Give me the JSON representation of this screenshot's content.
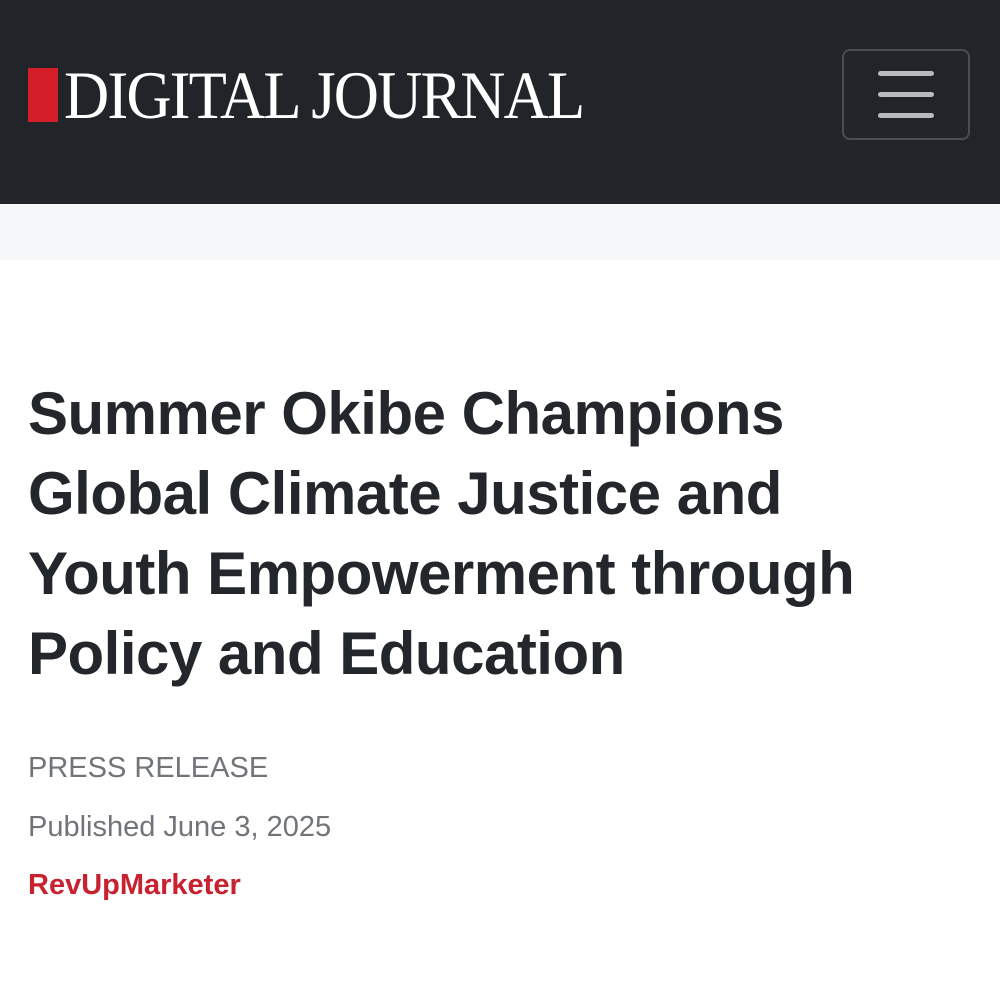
{
  "header": {
    "logo_text": "DIGITAL JOURNAL",
    "background_color": "#212428",
    "logo_mark_color": "#d41f2b",
    "menu_icon": "hamburger-menu-icon"
  },
  "article": {
    "title": "Summer Okibe Champions Global Climate Justice and Youth Empowerment through Policy and Education",
    "category": "PRESS RELEASE",
    "published": "Published June 3, 2025",
    "author": "RevUpMarketer",
    "author_color": "#c8212f"
  }
}
